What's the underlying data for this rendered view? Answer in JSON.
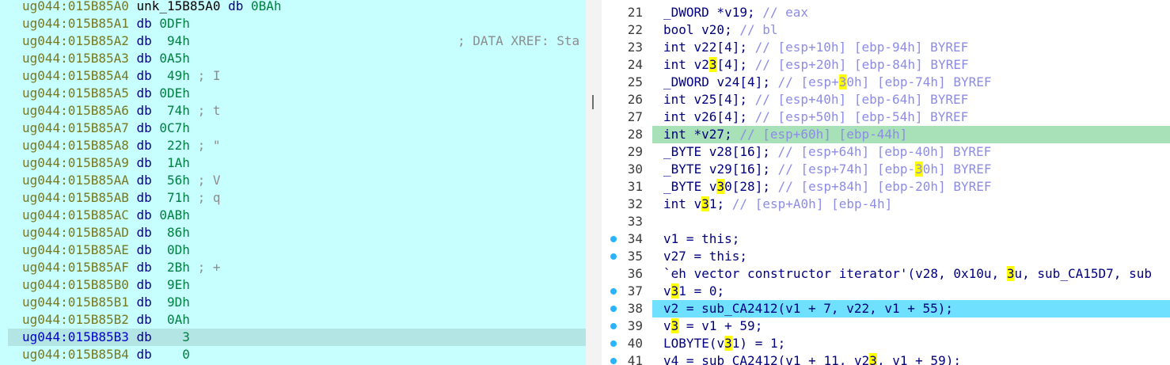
{
  "disasm": {
    "header": {
      "addr": "ug044:015B85A0",
      "label": "unk_15B85A0",
      "op": "db",
      "val": "0BAh",
      "comment": "; DATA XREF: Sta"
    },
    "rows": [
      {
        "addr": "ug044:015B85A1",
        "op": "db",
        "val": "0DFh",
        "cmt": ""
      },
      {
        "addr": "ug044:015B85A2",
        "op": "db",
        "val": " 94h",
        "cmt": ""
      },
      {
        "addr": "ug044:015B85A3",
        "op": "db",
        "val": "0A5h",
        "cmt": ""
      },
      {
        "addr": "ug044:015B85A4",
        "op": "db",
        "val": " 49h",
        "cmt": "; I"
      },
      {
        "addr": "ug044:015B85A5",
        "op": "db",
        "val": "0DEh",
        "cmt": ""
      },
      {
        "addr": "ug044:015B85A6",
        "op": "db",
        "val": " 74h",
        "cmt": "; t"
      },
      {
        "addr": "ug044:015B85A7",
        "op": "db",
        "val": "0C7h",
        "cmt": ""
      },
      {
        "addr": "ug044:015B85A8",
        "op": "db",
        "val": " 22h",
        "cmt": "; \""
      },
      {
        "addr": "ug044:015B85A9",
        "op": "db",
        "val": " 1Ah",
        "cmt": ""
      },
      {
        "addr": "ug044:015B85AA",
        "op": "db",
        "val": " 56h",
        "cmt": "; V"
      },
      {
        "addr": "ug044:015B85AB",
        "op": "db",
        "val": " 71h",
        "cmt": "; q"
      },
      {
        "addr": "ug044:015B85AC",
        "op": "db",
        "val": "0ABh",
        "cmt": ""
      },
      {
        "addr": "ug044:015B85AD",
        "op": "db",
        "val": " 86h",
        "cmt": ""
      },
      {
        "addr": "ug044:015B85AE",
        "op": "db",
        "val": " 0Dh",
        "cmt": ""
      },
      {
        "addr": "ug044:015B85AF",
        "op": "db",
        "val": " 2Bh",
        "cmt": "; +"
      },
      {
        "addr": "ug044:015B85B0",
        "op": "db",
        "val": " 9Eh",
        "cmt": ""
      },
      {
        "addr": "ug044:015B85B1",
        "op": "db",
        "val": " 9Dh",
        "cmt": ""
      },
      {
        "addr": "ug044:015B85B2",
        "op": "db",
        "val": " 0Ah",
        "cmt": ""
      },
      {
        "addr": "ug044:015B85B3",
        "op": "db",
        "val": "   3",
        "cmt": ""
      },
      {
        "addr": "ug044:015B85B4",
        "op": "db",
        "val": "   0",
        "cmt": ""
      }
    ]
  },
  "pseudocode": {
    "lines": [
      {
        "n": "21",
        "t": "_DWORD *v19; ",
        "c": "// eax"
      },
      {
        "n": "22",
        "t": "bool v20; ",
        "c": "// bl"
      },
      {
        "n": "23",
        "t": "int v22[4]; ",
        "c": "// [esp+10h] [ebp-94h] BYREF"
      },
      {
        "n": "24",
        "t": "int v23[4]; ",
        "c": "// [esp+20h] [ebp-84h] BYREF"
      },
      {
        "n": "25",
        "t": "_DWORD v24[4]; ",
        "c": "// [esp+30h] [ebp-74h] BYREF"
      },
      {
        "n": "26",
        "t": "int v25[4]; ",
        "c": "// [esp+40h] [ebp-64h] BYREF"
      },
      {
        "n": "27",
        "t": "int v26[4]; ",
        "c": "// [esp+50h] [ebp-54h] BYREF"
      },
      {
        "n": "28",
        "t": "int *v27; ",
        "c": "// [esp+60h] [ebp-44h]"
      },
      {
        "n": "29",
        "t": "_BYTE v28[16]; ",
        "c": "// [esp+64h] [ebp-40h] BYREF"
      },
      {
        "n": "30",
        "t": "_BYTE v29[16]; ",
        "c": "// [esp+74h] [ebp-30h] BYREF"
      },
      {
        "n": "31",
        "t": "_BYTE v30[28]; ",
        "c": "// [esp+84h] [ebp-20h] BYREF"
      },
      {
        "n": "32",
        "t": "int v31; ",
        "c": "// [esp+A0h] [ebp-4h]"
      },
      {
        "n": "33",
        "t": "",
        "c": ""
      },
      {
        "n": "34",
        "t": "v1 = this;",
        "c": ""
      },
      {
        "n": "35",
        "t": "v27 = this;",
        "c": ""
      },
      {
        "n": "36",
        "t": "`eh vector constructor iterator'(v28, 0x10u, 3u, sub_CA15D7, sub",
        "c": ""
      },
      {
        "n": "37",
        "t": "v31 = 0;",
        "c": ""
      },
      {
        "n": "38",
        "t": "v2 = sub_CA2412(v1 + 7, v22, v1 + 55);",
        "c": ""
      },
      {
        "n": "39",
        "t": "v3 = v1 + 59;",
        "c": ""
      },
      {
        "n": "40",
        "t": "LOBYTE(v31) = 1;",
        "c": ""
      },
      {
        "n": "41",
        "t": "v4 = sub_CA2412(v1 + 11, v23, v1 + 59);",
        "c": ""
      }
    ]
  },
  "colors": {
    "left_bg": "#c7ffff",
    "current_line": "#b3e5e5",
    "green_highlight": "#a8e0b8",
    "cyan_highlight": "#6fe1ff",
    "search_highlight": "#ffff00",
    "breakpoint_dot": "#2ab4ff"
  }
}
